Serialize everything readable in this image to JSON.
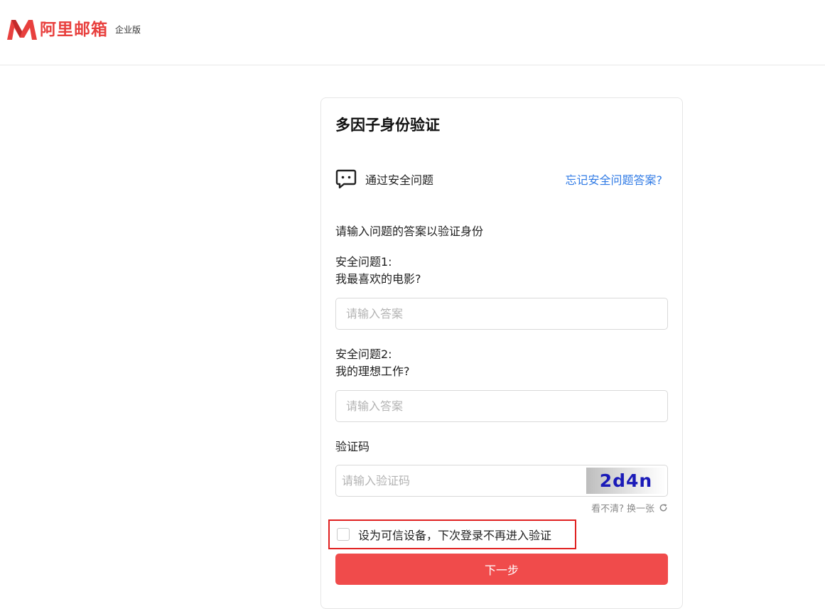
{
  "brand": {
    "name": "阿里邮箱",
    "edition": "企业版",
    "color": "#e8403e"
  },
  "card": {
    "title": "多因子身份验证",
    "method": {
      "icon": "chat-question-icon",
      "label": "通过安全问题",
      "forgot_link": "忘记安全问题答案?"
    },
    "instruction": "请输入问题的答案以验证身份",
    "questions": [
      {
        "label": "安全问题1:",
        "text": "我最喜欢的电影?",
        "answer_value": "",
        "placeholder": "请输入答案"
      },
      {
        "label": "安全问题2:",
        "text": "我的理想工作?",
        "answer_value": "",
        "placeholder": "请输入答案"
      }
    ],
    "captcha": {
      "label": "验证码",
      "value": "",
      "placeholder": "请输入验证码",
      "image_text": "2d4n",
      "refresh_prompt": "看不清?",
      "refresh_link": "换一张",
      "refresh_icon": "refresh-icon"
    },
    "trust_device": {
      "checked": false,
      "label": "设为可信设备，下次登录不再进入验证"
    },
    "next_button": "下一步",
    "accent_color": "#f04b4b",
    "link_color": "#2f7ae5"
  }
}
